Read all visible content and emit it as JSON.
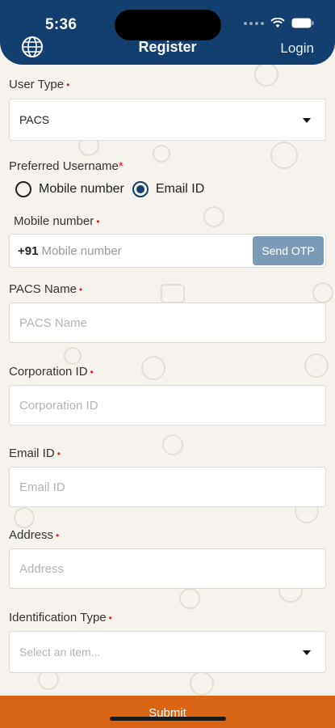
{
  "status_bar": {
    "time": "5:36"
  },
  "header": {
    "title": "Register",
    "login_label": "Login",
    "globe_icon": "globe-icon"
  },
  "form": {
    "user_type": {
      "label": "User Type",
      "value": "PACS"
    },
    "preferred_username": {
      "label": "Preferred Username",
      "options": [
        {
          "label": "Mobile number",
          "selected": false
        },
        {
          "label": "Email ID",
          "selected": true
        }
      ]
    },
    "mobile": {
      "label": "Mobile number",
      "prefix": "+91",
      "placeholder": "Mobile number",
      "otp_button": "Send OTP"
    },
    "pacs_name": {
      "label": "PACS Name",
      "placeholder": "PACS Name"
    },
    "corporation_id": {
      "label": "Corporation ID",
      "placeholder": "Corporation ID"
    },
    "email_id": {
      "label": "Email ID",
      "placeholder": "Email ID"
    },
    "address": {
      "label": "Address",
      "placeholder": "Address"
    },
    "identification_type": {
      "label": "Identification Type",
      "placeholder": "Select an item..."
    },
    "required_mark": "•",
    "required_star": "*"
  },
  "submit_label": "Submit",
  "colors": {
    "header": "#123f6e",
    "submit": "#d96414",
    "otp": "#7b9cb8",
    "required": "#dd2222",
    "background": "#f6f3ee"
  }
}
